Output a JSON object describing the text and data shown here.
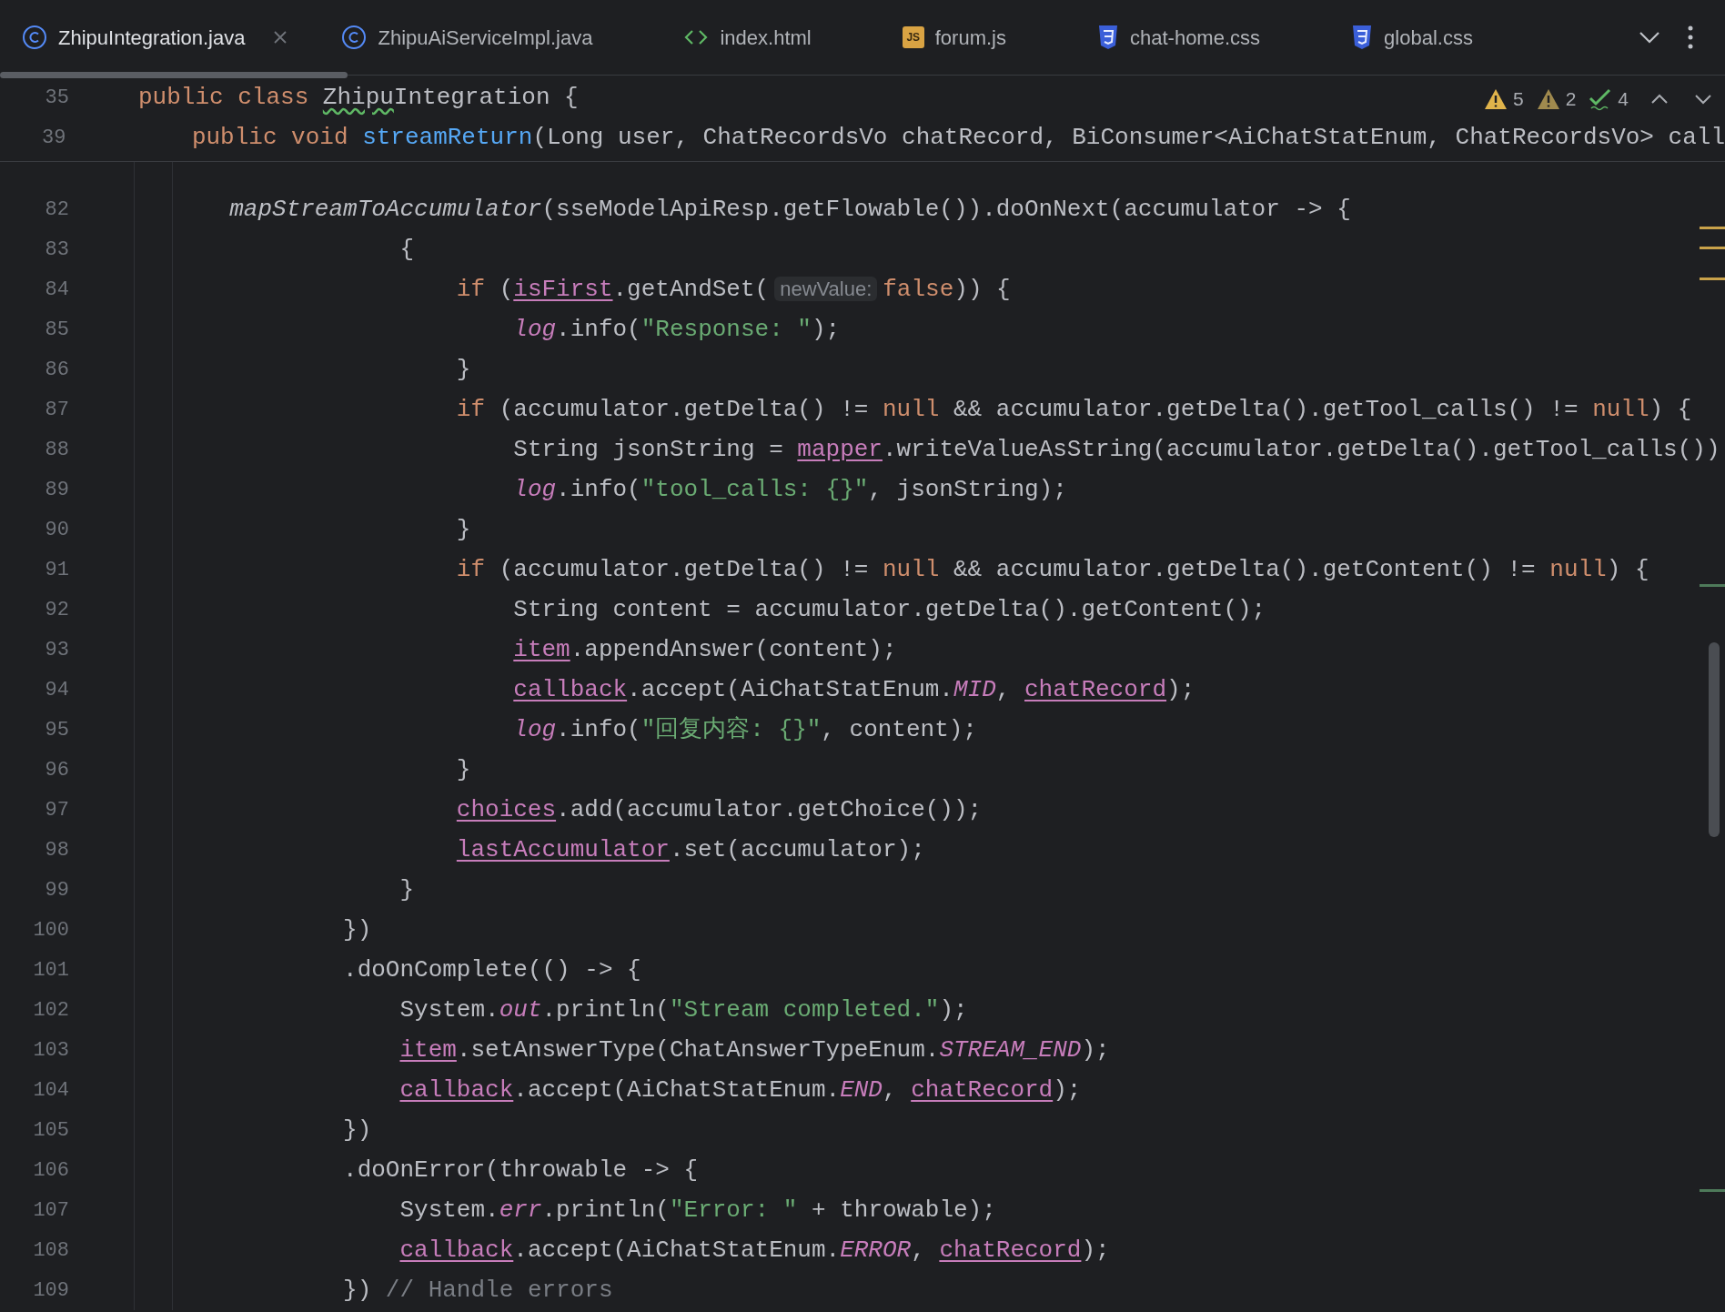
{
  "tabs": [
    {
      "label": "ZhipuIntegration.java",
      "kind": "class",
      "selected": true,
      "closable": true
    },
    {
      "label": "ZhipuAiServiceImpl.java",
      "kind": "class",
      "selected": false,
      "closable": false
    },
    {
      "label": "index.html",
      "kind": "html",
      "selected": false,
      "closable": false
    },
    {
      "label": "forum.js",
      "kind": "js",
      "icon_label": "JS",
      "selected": false,
      "closable": false
    },
    {
      "label": "chat-home.css",
      "kind": "css",
      "selected": false,
      "closable": false
    },
    {
      "label": "global.css",
      "kind": "css",
      "selected": false,
      "closable": false
    }
  ],
  "inspections": [
    {
      "kind": "warning",
      "count": "5"
    },
    {
      "kind": "weak_warning",
      "count": "2"
    },
    {
      "kind": "ok",
      "count": "4"
    }
  ],
  "sticky_lines": [
    {
      "number": "35",
      "tokens": [
        {
          "kind": "keyword",
          "text": "public class "
        },
        {
          "kind": "typo",
          "text": "Zhipu"
        },
        {
          "kind": "plain",
          "text": "Integration {"
        }
      ]
    },
    {
      "number": "39",
      "tokens": [
        {
          "kind": "keyword",
          "text": "    public void "
        },
        {
          "kind": "decl",
          "text": "streamReturn"
        },
        {
          "kind": "plain",
          "text": "(Long user, ChatRecordsVo chatRecord, BiConsumer<AiChatStatEnum, ChatRecordsVo> call"
        }
      ]
    }
  ],
  "lines": [
    {
      "number": "82",
      "tokens": [
        {
          "kind": "italic",
          "text": "       mapStreamToAccumulator"
        },
        {
          "kind": "plain",
          "text": "(sseModelApiResp.getFlowable()).doOnNext(accumulator -> {"
        }
      ]
    },
    {
      "number": "83",
      "tokens": [
        {
          "kind": "plain",
          "text": "                   {"
        }
      ]
    },
    {
      "number": "84",
      "tokens": [
        {
          "kind": "keyword",
          "text": "                       if"
        },
        {
          "kind": "plain",
          "text": " ("
        },
        {
          "kind": "field",
          "text": "isFirst"
        },
        {
          "kind": "plain",
          "text": ".getAndSet("
        },
        {
          "kind": "hint",
          "text": "newValue:"
        },
        {
          "kind": "keyword",
          "text": "false"
        },
        {
          "kind": "plain",
          "text": ")) {"
        }
      ]
    },
    {
      "number": "85",
      "tokens": [
        {
          "kind": "static",
          "text": "                           log"
        },
        {
          "kind": "plain",
          "text": ".info("
        },
        {
          "kind": "string",
          "text": "\"Response: \""
        },
        {
          "kind": "plain",
          "text": ");"
        }
      ]
    },
    {
      "number": "86",
      "tokens": [
        {
          "kind": "plain",
          "text": "                       }"
        }
      ]
    },
    {
      "number": "87",
      "tokens": [
        {
          "kind": "keyword",
          "text": "                       if"
        },
        {
          "kind": "plain",
          "text": " (accumulator.getDelta() != "
        },
        {
          "kind": "keyword",
          "text": "null"
        },
        {
          "kind": "plain",
          "text": " && accumulator.getDelta().getTool_calls() != "
        },
        {
          "kind": "keyword",
          "text": "null"
        },
        {
          "kind": "plain",
          "text": ") {"
        }
      ]
    },
    {
      "number": "88",
      "tokens": [
        {
          "kind": "plain",
          "text": "                           String jsonString = "
        },
        {
          "kind": "field",
          "text": "mapper"
        },
        {
          "kind": "plain",
          "text": ".writeValueAsString(accumulator.getDelta().getTool_calls())"
        }
      ]
    },
    {
      "number": "89",
      "tokens": [
        {
          "kind": "static",
          "text": "                           log"
        },
        {
          "kind": "plain",
          "text": ".info("
        },
        {
          "kind": "string",
          "text": "\"tool_calls: {}\""
        },
        {
          "kind": "plain",
          "text": ", jsonString);"
        }
      ]
    },
    {
      "number": "90",
      "tokens": [
        {
          "kind": "plain",
          "text": "                       }"
        }
      ]
    },
    {
      "number": "91",
      "tokens": [
        {
          "kind": "keyword",
          "text": "                       if"
        },
        {
          "kind": "plain",
          "text": " (accumulator.getDelta() != "
        },
        {
          "kind": "keyword",
          "text": "null"
        },
        {
          "kind": "plain",
          "text": " && accumulator.getDelta().getContent() != "
        },
        {
          "kind": "keyword",
          "text": "null"
        },
        {
          "kind": "plain",
          "text": ") {"
        }
      ]
    },
    {
      "number": "92",
      "tokens": [
        {
          "kind": "plain",
          "text": "                           String content = accumulator.getDelta().getContent();"
        }
      ]
    },
    {
      "number": "93",
      "tokens": [
        {
          "kind": "field",
          "text": "                           item"
        },
        {
          "kind": "plain",
          "text": ".appendAnswer(content);"
        }
      ]
    },
    {
      "number": "94",
      "tokens": [
        {
          "kind": "field",
          "text": "                           callback"
        },
        {
          "kind": "plain",
          "text": ".accept(AiChatStatEnum."
        },
        {
          "kind": "static",
          "text": "MID"
        },
        {
          "kind": "plain",
          "text": ", "
        },
        {
          "kind": "field",
          "text": "chatRecord"
        },
        {
          "kind": "plain",
          "text": ");"
        }
      ]
    },
    {
      "number": "95",
      "tokens": [
        {
          "kind": "static",
          "text": "                           log"
        },
        {
          "kind": "plain",
          "text": ".info("
        },
        {
          "kind": "string",
          "text": "\"回复内容: {}\""
        },
        {
          "kind": "plain",
          "text": ", content);"
        }
      ]
    },
    {
      "number": "96",
      "tokens": [
        {
          "kind": "plain",
          "text": "                       }"
        }
      ]
    },
    {
      "number": "97",
      "tokens": [
        {
          "kind": "field",
          "text": "                       choices"
        },
        {
          "kind": "plain",
          "text": ".add(accumulator.getChoice());"
        }
      ]
    },
    {
      "number": "98",
      "tokens": [
        {
          "kind": "field",
          "text": "                       lastAccumulator"
        },
        {
          "kind": "plain",
          "text": ".set(accumulator);"
        }
      ]
    },
    {
      "number": "99",
      "tokens": [
        {
          "kind": "plain",
          "text": "                   }"
        }
      ]
    },
    {
      "number": "100",
      "tokens": [
        {
          "kind": "plain",
          "text": "               })"
        }
      ]
    },
    {
      "number": "101",
      "tokens": [
        {
          "kind": "plain",
          "text": "               .doOnComplete(() -> {"
        }
      ]
    },
    {
      "number": "102",
      "tokens": [
        {
          "kind": "plain",
          "text": "                   System."
        },
        {
          "kind": "static",
          "text": "out"
        },
        {
          "kind": "plain",
          "text": ".println("
        },
        {
          "kind": "string",
          "text": "\"Stream completed.\""
        },
        {
          "kind": "plain",
          "text": ");"
        }
      ]
    },
    {
      "number": "103",
      "tokens": [
        {
          "kind": "field",
          "text": "                   item"
        },
        {
          "kind": "plain",
          "text": ".setAnswerType(ChatAnswerTypeEnum."
        },
        {
          "kind": "static",
          "text": "STREAM_END"
        },
        {
          "kind": "plain",
          "text": ");"
        }
      ]
    },
    {
      "number": "104",
      "tokens": [
        {
          "kind": "field",
          "text": "                   callback"
        },
        {
          "kind": "plain",
          "text": ".accept(AiChatStatEnum."
        },
        {
          "kind": "static",
          "text": "END"
        },
        {
          "kind": "plain",
          "text": ", "
        },
        {
          "kind": "field",
          "text": "chatRecord"
        },
        {
          "kind": "plain",
          "text": ");"
        }
      ]
    },
    {
      "number": "105",
      "tokens": [
        {
          "kind": "plain",
          "text": "               })"
        }
      ]
    },
    {
      "number": "106",
      "tokens": [
        {
          "kind": "plain",
          "text": "               .doOnError(throwable -> {"
        }
      ]
    },
    {
      "number": "107",
      "tokens": [
        {
          "kind": "plain",
          "text": "                   System."
        },
        {
          "kind": "static",
          "text": "err"
        },
        {
          "kind": "plain",
          "text": ".println("
        },
        {
          "kind": "string",
          "text": "\"Error: \""
        },
        {
          "kind": "plain",
          "text": " + throwable);"
        }
      ]
    },
    {
      "number": "108",
      "tokens": [
        {
          "kind": "field",
          "text": "                   callback"
        },
        {
          "kind": "plain",
          "text": ".accept(AiChatStatEnum."
        },
        {
          "kind": "static",
          "text": "ERROR"
        },
        {
          "kind": "plain",
          "text": ", "
        },
        {
          "kind": "field",
          "text": "chatRecord"
        },
        {
          "kind": "plain",
          "text": ");"
        }
      ]
    },
    {
      "number": "109",
      "tokens": [
        {
          "kind": "plain",
          "text": "               }) "
        },
        {
          "kind": "comment",
          "text": "// Handle errors"
        }
      ]
    }
  ]
}
